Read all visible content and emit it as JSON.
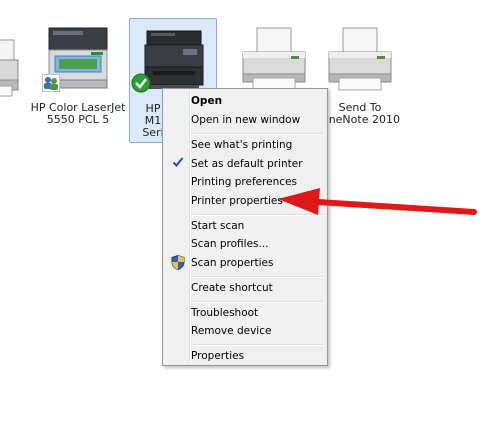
{
  "devices": [
    {
      "label": "",
      "icon": "printer-icon"
    },
    {
      "label": "HP Color LaserJet\n5550 PCL 5",
      "icon": "color-laser-printer-icon",
      "overlay_icon": "shared-users-icon"
    },
    {
      "label": "HP\nM1\nSeri",
      "icon": "multifunction-printer-icon",
      "overlay_icon": "default-check-icon"
    },
    {
      "label": "",
      "icon": "printer-icon"
    },
    {
      "label": "Send To\nOneNote 2010",
      "icon": "printer-icon"
    }
  ],
  "context_menu": {
    "items": [
      {
        "label": "Open",
        "bold": true
      },
      {
        "label": "Open in new window"
      },
      {
        "label": "See what's printing"
      },
      {
        "label": "Set as default printer",
        "icon": "checkmark-icon"
      },
      {
        "label": "Printing preferences"
      },
      {
        "label": "Printer properties"
      },
      {
        "label": "Start scan"
      },
      {
        "label": "Scan profiles..."
      },
      {
        "label": "Scan properties",
        "icon": "uac-shield-icon"
      },
      {
        "label": "Create shortcut"
      },
      {
        "label": "Troubleshoot"
      },
      {
        "label": "Remove device"
      },
      {
        "label": "Properties"
      }
    ]
  },
  "annotation": {
    "icon": "red-arrow-icon",
    "color": "#e01818"
  },
  "colors": {
    "selection_bg": "#dbe9fb",
    "selection_border": "#84acdd",
    "menu_bg": "#f0f0f0",
    "check": "#1c4fb8"
  }
}
